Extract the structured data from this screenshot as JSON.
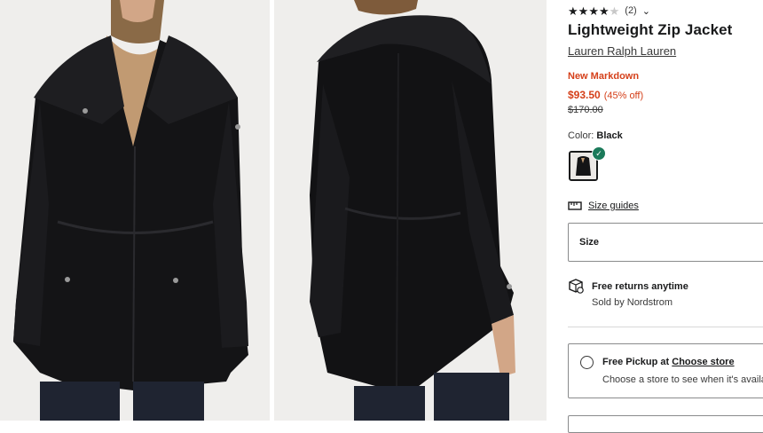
{
  "product": {
    "title": "Lightweight Zip Jacket",
    "brand": "Lauren Ralph Lauren",
    "rating": 4,
    "rating_max": 5,
    "review_count": "(2)",
    "markdown_label": "New Markdown",
    "price": "$93.50",
    "discount": "(45% off)",
    "original_price": "$170.00"
  },
  "color": {
    "label": "Color:",
    "value": "Black"
  },
  "size_guides": {
    "label": "Size guides"
  },
  "size_select": {
    "label": "Size"
  },
  "returns": {
    "title": "Free returns anytime",
    "sold_by": "Sold by Nordstrom"
  },
  "pickup": {
    "label": "Free Pickup at",
    "link": "Choose store",
    "subtext": "Choose a store to see when it's available"
  },
  "icons": {
    "star": "star-icon",
    "chevron": "chevron-down-icon",
    "check": "checkmark-icon",
    "ruler": "ruler-icon",
    "returns": "returns-box-icon"
  },
  "colors": {
    "markdown": "#d5401a",
    "check_badge": "#1b7a5a"
  }
}
